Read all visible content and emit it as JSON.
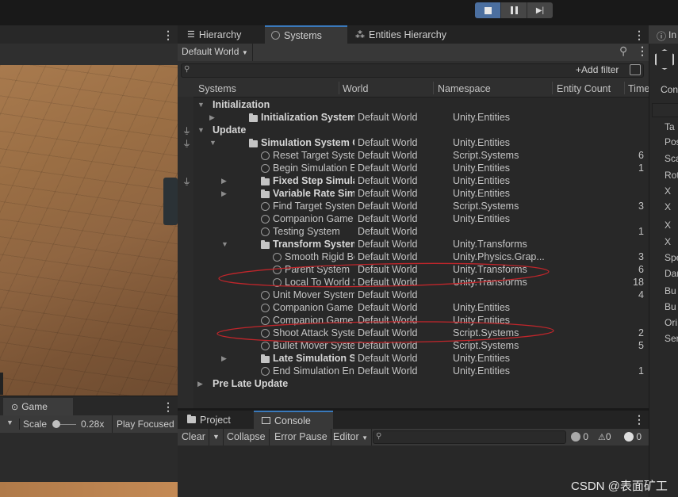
{
  "hierarchy_tabs": {
    "hierarchy": "Hierarchy",
    "systems": "Systems",
    "entities": "Entities Hierarchy"
  },
  "world_dropdown": "Default World",
  "add_filter": "Add filter",
  "columns": {
    "systems": "Systems",
    "world": "World",
    "namespace": "Namespace",
    "entity_count": "Entity Count",
    "time": "Time"
  },
  "rows": [
    {
      "name": "Initialization",
      "world": "",
      "ns": "",
      "count": "",
      "indent": 0,
      "type": "group",
      "arrow": "▼",
      "plug": false
    },
    {
      "name": "Initialization System Gr...",
      "world": "Default World",
      "ns": "Unity.Entities",
      "count": "",
      "indent": 1,
      "type": "folder",
      "arrow": "▶",
      "plug": false
    },
    {
      "name": "Update",
      "world": "",
      "ns": "",
      "count": "",
      "indent": 0,
      "type": "group",
      "arrow": "▼",
      "plug": true
    },
    {
      "name": "Simulation System Group",
      "world": "Default World",
      "ns": "Unity.Entities",
      "count": "",
      "indent": 1,
      "type": "folder",
      "arrow": "▼",
      "plug": true
    },
    {
      "name": "Reset Target System",
      "world": "Default World",
      "ns": "Script.Systems",
      "count": "6",
      "indent": 2,
      "type": "system",
      "arrow": "",
      "plug": false
    },
    {
      "name": "Begin Simulation Entit...",
      "world": "Default World",
      "ns": "Unity.Entities",
      "count": "1",
      "indent": 2,
      "type": "system",
      "arrow": "",
      "plug": false
    },
    {
      "name": "Fixed Step Simulatio...",
      "world": "Default World",
      "ns": "Unity.Entities",
      "count": "",
      "indent": 2,
      "type": "folder",
      "arrow": "▶",
      "plug": true
    },
    {
      "name": "Variable Rate Simulat...",
      "world": "Default World",
      "ns": "Unity.Entities",
      "count": "",
      "indent": 2,
      "type": "folder",
      "arrow": "▶",
      "plug": false
    },
    {
      "name": "Find Target System",
      "world": "Default World",
      "ns": "Script.Systems",
      "count": "3",
      "indent": 2,
      "type": "system",
      "arrow": "",
      "plug": false
    },
    {
      "name": "Companion Game Obj...",
      "world": "Default World",
      "ns": "Unity.Entities",
      "count": "",
      "indent": 2,
      "type": "system",
      "arrow": "",
      "plug": false
    },
    {
      "name": "Testing System",
      "world": "Default World",
      "ns": "",
      "count": "1",
      "indent": 2,
      "type": "system",
      "arrow": "",
      "plug": false
    },
    {
      "name": "Transform System Gr...",
      "world": "Default World",
      "ns": "Unity.Transforms",
      "count": "",
      "indent": 2,
      "type": "folder",
      "arrow": "▼",
      "plug": false
    },
    {
      "name": "Smooth Rigid Bodi...",
      "world": "Default World",
      "ns": "Unity.Physics.Grap...",
      "count": "3",
      "indent": 3,
      "type": "system",
      "arrow": "",
      "plug": false
    },
    {
      "name": "Parent System",
      "world": "Default World",
      "ns": "Unity.Transforms",
      "count": "6",
      "indent": 3,
      "type": "system",
      "arrow": "",
      "plug": false
    },
    {
      "name": "Local To World Sys...",
      "world": "Default World",
      "ns": "Unity.Transforms",
      "count": "18",
      "indent": 3,
      "type": "system",
      "arrow": "",
      "plug": false
    },
    {
      "name": "Unit Mover System",
      "world": "Default World",
      "ns": "",
      "count": "4",
      "indent": 2,
      "type": "system",
      "arrow": "",
      "plug": false
    },
    {
      "name": "Companion Game Obj...",
      "world": "Default World",
      "ns": "Unity.Entities",
      "count": "",
      "indent": 2,
      "type": "system",
      "arrow": "",
      "plug": false
    },
    {
      "name": "Companion Game Obj...",
      "world": "Default World",
      "ns": "Unity.Entities",
      "count": "",
      "indent": 2,
      "type": "system",
      "arrow": "",
      "plug": false
    },
    {
      "name": "Shoot Attack System",
      "world": "Default World",
      "ns": "Script.Systems",
      "count": "2",
      "indent": 2,
      "type": "system",
      "arrow": "",
      "plug": false
    },
    {
      "name": "Bullet Mover System",
      "world": "Default World",
      "ns": "Script.Systems",
      "count": "5",
      "indent": 2,
      "type": "system",
      "arrow": "",
      "plug": false
    },
    {
      "name": "Late Simulation Syst...",
      "world": "Default World",
      "ns": "Unity.Entities",
      "count": "",
      "indent": 2,
      "type": "folder",
      "arrow": "▶",
      "plug": false
    },
    {
      "name": "End Simulation Entity ...",
      "world": "Default World",
      "ns": "Unity.Entities",
      "count": "1",
      "indent": 2,
      "type": "system",
      "arrow": "",
      "plug": false
    },
    {
      "name": "Pre Late Update",
      "world": "",
      "ns": "",
      "count": "",
      "indent": 0,
      "type": "group",
      "arrow": "▶",
      "plug": false
    }
  ],
  "game": {
    "tab": "Game",
    "scale_label": "Scale",
    "scale_value": "0.28x",
    "play_focused": "Play Focused"
  },
  "console": {
    "project_tab": "Project",
    "console_tab": "Console",
    "clear": "Clear",
    "collapse": "Collapse",
    "error_pause": "Error Pause",
    "editor": "Editor",
    "log_count": "0",
    "warn_count": "0",
    "error_count": "0"
  },
  "inspector": {
    "tab": "In",
    "con": "Con",
    "items": [
      "Ta",
      "Pos",
      "Sca",
      "Rot",
      "X",
      "X",
      "X",
      "X",
      "Spe",
      "Dar",
      "Bu",
      "Bu",
      "Ori",
      "Ser"
    ]
  },
  "watermark": "CSDN @表面矿工"
}
